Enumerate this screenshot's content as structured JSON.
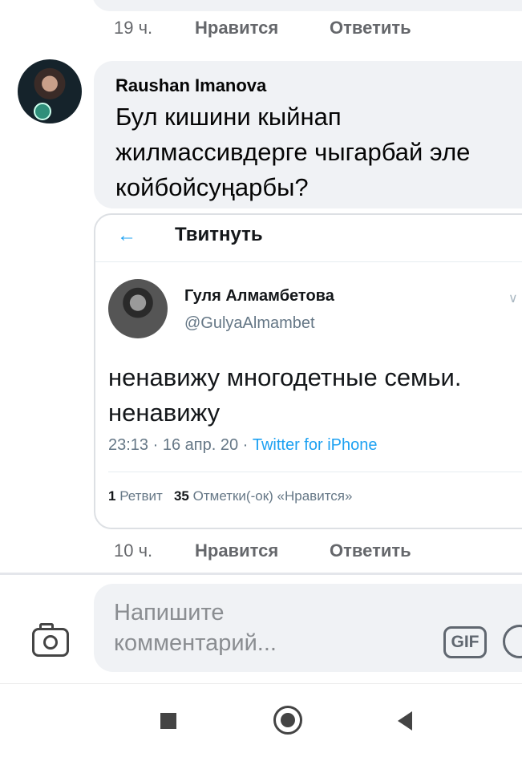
{
  "previous_comment": {
    "time": "19 ч.",
    "like_label": "Нравится",
    "reply_label": "Ответить"
  },
  "comment": {
    "author": "Raushan Imanova",
    "text": "Бул кишини кыйнап жилмассивдерге чыгарбай эле койбойсуңарбы?",
    "time": "10 ч.",
    "like_label": "Нравится",
    "reply_label": "Ответить"
  },
  "tweet_screenshot": {
    "back_icon": "arrow-left-icon",
    "header_title": "Твитнуть",
    "name": "Гуля Алмамбетова",
    "handle": "@GulyaAlmambet",
    "text": "ненавижу многодетные семьи. ненавижу",
    "timestamp": "23:13 · 16 апр. 20 · ",
    "source": "Twitter for iPhone",
    "retweets_count": "1",
    "retweets_label": "Ретвит",
    "likes_count": "35",
    "likes_label": "Отметки(-ок) «Нравится»",
    "accent_color": "#1da1f2"
  },
  "composer": {
    "placeholder": "Напишите комментарий...",
    "gif_label": "GIF",
    "camera_icon": "camera-icon",
    "emoji_icon": "emoji-icon"
  },
  "navigation": {
    "recents_icon": "square-icon",
    "home_icon": "circle-icon",
    "back_icon": "triangle-back-icon"
  }
}
